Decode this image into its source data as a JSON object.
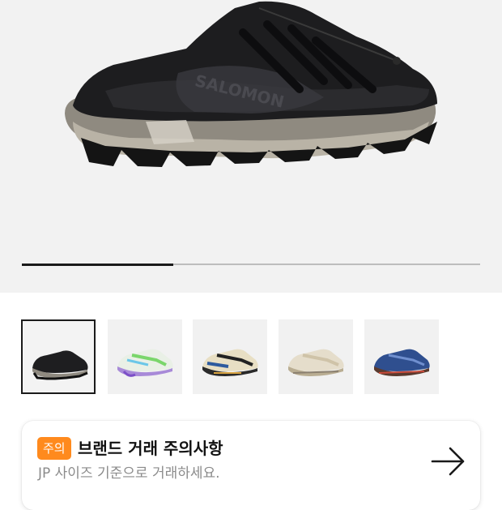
{
  "gallery": {
    "progress_fraction": 0.33,
    "accent_color": "#1a1a1a",
    "track_color": "#bdbdbd",
    "thumbnails": [
      {
        "name": "black-mule",
        "selected": true
      },
      {
        "name": "white-green-purple",
        "selected": false
      },
      {
        "name": "cream-black-blue",
        "selected": false
      },
      {
        "name": "beige-cream",
        "selected": false
      },
      {
        "name": "blue-brown",
        "selected": false
      }
    ]
  },
  "notice": {
    "badge": "주의",
    "title": "브랜드 거래 주의사항",
    "subtitle": "JP 사이즈 기준으로 거래하세요.",
    "badge_color": "#ff8a1d",
    "action_icon": "arrow-right-icon"
  }
}
